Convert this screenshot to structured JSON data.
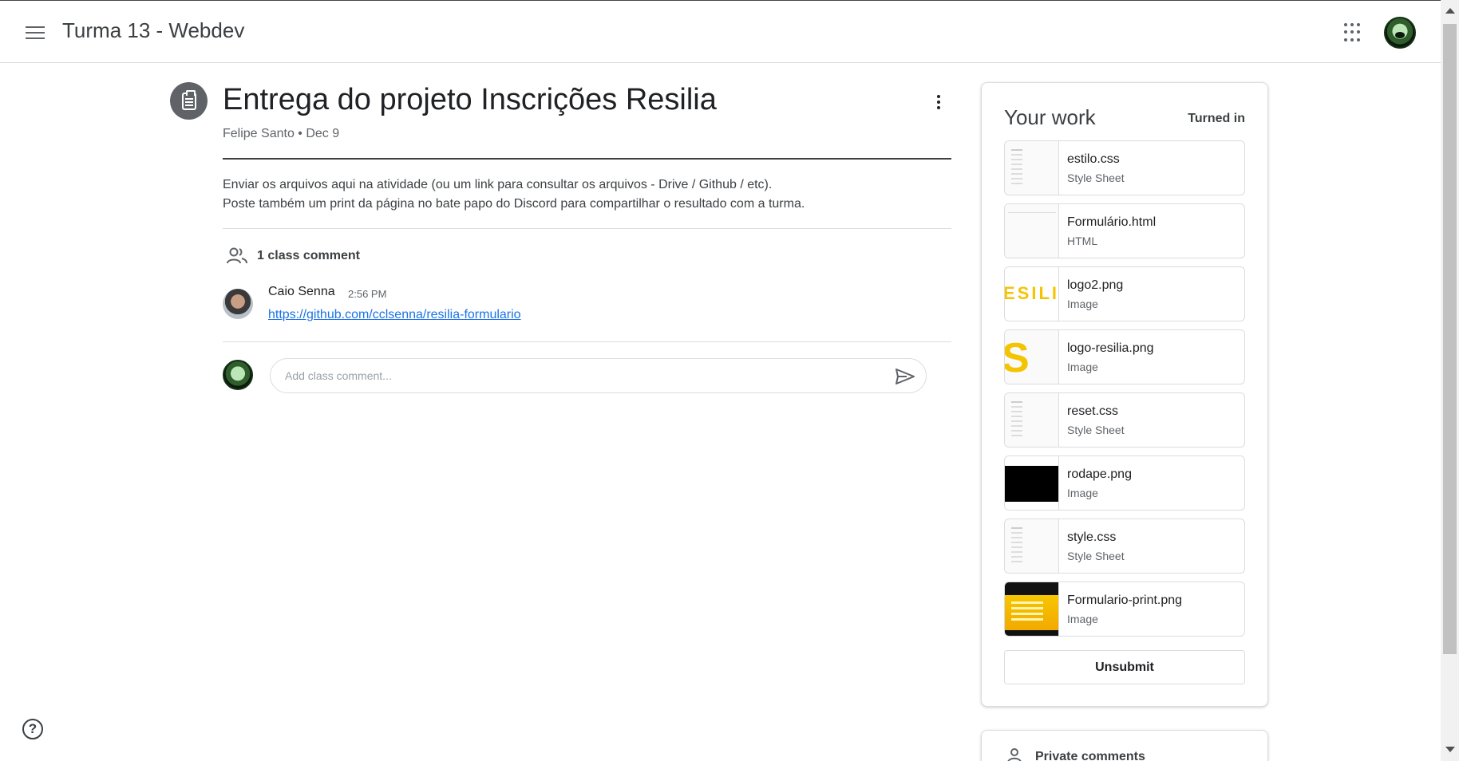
{
  "header": {
    "class_title": "Turma 13 - Webdev"
  },
  "assignment": {
    "title": "Entrega do projeto Inscrições Resilia",
    "meta": "Felipe Santo • Dec 9",
    "instructions_line1": "Enviar os arquivos aqui na atividade (ou um link para consultar os arquivos - Drive / Github / etc).",
    "instructions_line2": "Poste também um print da página no bate papo do Discord para compartilhar o resultado com a turma."
  },
  "comments": {
    "count_label": "1 class comment",
    "items": [
      {
        "author": "Caio Senna",
        "time": "2:56 PM",
        "text": "https://github.com/cclsenna/resilia-formulario"
      }
    ],
    "input_placeholder": "Add class comment..."
  },
  "your_work": {
    "title": "Your work",
    "status": "Turned in",
    "files": [
      {
        "name": "estilo.css",
        "type": "Style Sheet",
        "thumb": "doc"
      },
      {
        "name": "Formulário.html",
        "type": "HTML",
        "thumb": "html"
      },
      {
        "name": "logo2.png",
        "type": "Image",
        "thumb": "ESILI"
      },
      {
        "name": "logo-resilia.png",
        "type": "Image",
        "thumb": "S I"
      },
      {
        "name": "reset.css",
        "type": "Style Sheet",
        "thumb": "doc"
      },
      {
        "name": "rodape.png",
        "type": "Image",
        "thumb": "black"
      },
      {
        "name": "style.css",
        "type": "Style Sheet",
        "thumb": "doc"
      },
      {
        "name": "Formulario-print.png",
        "type": "Image",
        "thumb": "print"
      }
    ],
    "unsubmit_label": "Unsubmit"
  },
  "private_comments": {
    "label": "Private comments"
  },
  "help": {
    "icon_text": "?"
  },
  "colors": {
    "link": "#1a73e8",
    "icon_gray": "#5f6368",
    "logo_yellow": "#f5c400"
  }
}
